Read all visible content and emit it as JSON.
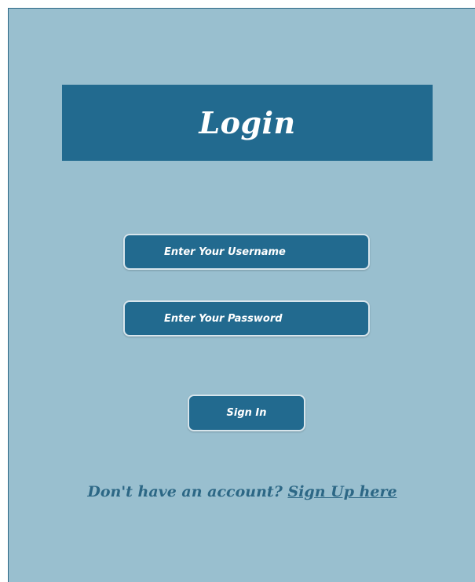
{
  "header": {
    "title": "Login"
  },
  "form": {
    "username_placeholder": "Enter Your Username",
    "password_placeholder": "Enter Your Password",
    "sign_in_label": "Sign In"
  },
  "footer": {
    "prompt_text": "Don't have an account?",
    "signup_link_text": "Sign Up here"
  },
  "colors": {
    "background": "#99bfcf",
    "accent": "#226a8f",
    "text_link": "#2c6785",
    "input_border": "#d7e5ec"
  }
}
